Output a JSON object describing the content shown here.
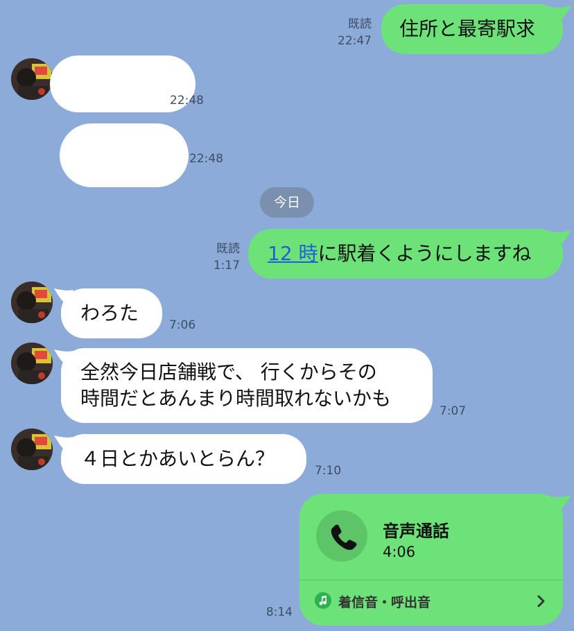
{
  "messages": {
    "m1": {
      "text": "住所と最寄駅求",
      "read": "既読",
      "time": "22:47"
    },
    "m2": {
      "time": "22:48"
    },
    "m3": {
      "time": "22:48"
    },
    "date_divider": "今日",
    "m4": {
      "link_text": "12 時",
      "text_rest": "に駅着くようにしますね",
      "read": "既読",
      "time": "1:17"
    },
    "m5": {
      "text": "わろた",
      "time": "7:06"
    },
    "m6": {
      "line1": "全然今日店舗戦で、  行くからその",
      "line2": "時間だとあんまり時間取れないかも",
      "time": "7:07"
    },
    "m7": {
      "text": "４日とかあいとらん？",
      "time": "7:10"
    },
    "call": {
      "title": "音声通話",
      "duration": "4:06",
      "footer_label": "着信音・呼出音",
      "time": "8:14"
    }
  },
  "colors": {
    "background": "#8cabd9",
    "outgoing_bubble": "#6de279",
    "incoming_bubble": "#ffffff",
    "link": "#1f5fd6"
  }
}
